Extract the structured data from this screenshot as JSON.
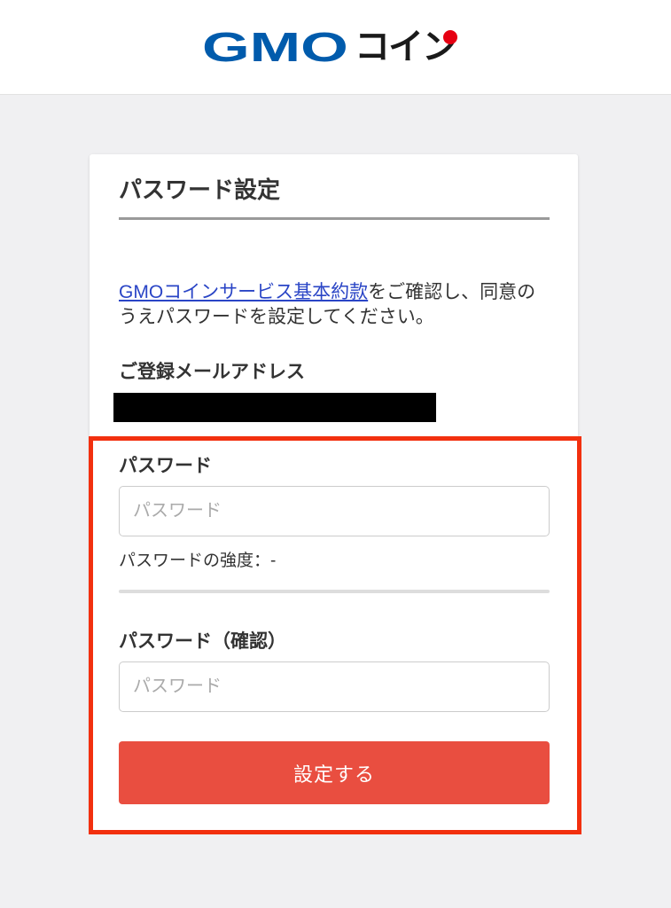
{
  "header": {
    "logo_gmo": "GMO",
    "logo_coin": "コイン"
  },
  "card": {
    "title": "パスワード設定",
    "intro_link": "GMOコインサービス基本約款",
    "intro_text": "をご確認し、同意のうえパスワードを設定してください。",
    "email_label": "ご登録メールアドレス",
    "password_label": "パスワード",
    "password_placeholder": "パスワード",
    "password_value": "",
    "strength_label": "パスワードの強度：-",
    "strength_level": 0,
    "confirm_label": "パスワード（確認）",
    "confirm_placeholder": "パスワード",
    "confirm_value": "",
    "submit_label": "設定する"
  },
  "colors": {
    "page_background": "#f0f0f2",
    "logo_blue": "#005bac",
    "logo_red": "#e60012",
    "link": "#2a45c6",
    "submit_button": "#e94e40",
    "highlight_border": "#f2300f",
    "text": "#333333"
  }
}
